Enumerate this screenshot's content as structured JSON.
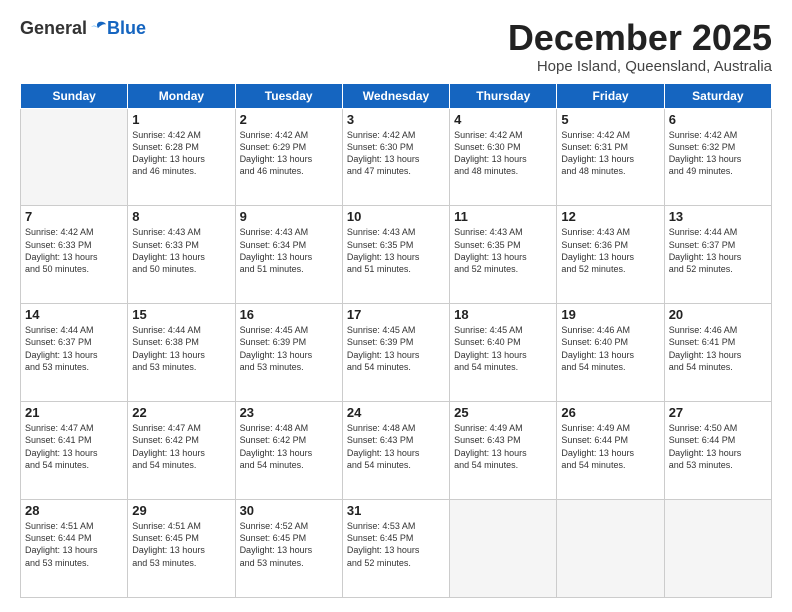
{
  "header": {
    "logo_general": "General",
    "logo_blue": "Blue",
    "month_title": "December 2025",
    "location": "Hope Island, Queensland, Australia"
  },
  "days_of_week": [
    "Sunday",
    "Monday",
    "Tuesday",
    "Wednesday",
    "Thursday",
    "Friday",
    "Saturday"
  ],
  "weeks": [
    [
      {
        "day": "",
        "info": ""
      },
      {
        "day": "1",
        "info": "Sunrise: 4:42 AM\nSunset: 6:28 PM\nDaylight: 13 hours\nand 46 minutes."
      },
      {
        "day": "2",
        "info": "Sunrise: 4:42 AM\nSunset: 6:29 PM\nDaylight: 13 hours\nand 46 minutes."
      },
      {
        "day": "3",
        "info": "Sunrise: 4:42 AM\nSunset: 6:30 PM\nDaylight: 13 hours\nand 47 minutes."
      },
      {
        "day": "4",
        "info": "Sunrise: 4:42 AM\nSunset: 6:30 PM\nDaylight: 13 hours\nand 48 minutes."
      },
      {
        "day": "5",
        "info": "Sunrise: 4:42 AM\nSunset: 6:31 PM\nDaylight: 13 hours\nand 48 minutes."
      },
      {
        "day": "6",
        "info": "Sunrise: 4:42 AM\nSunset: 6:32 PM\nDaylight: 13 hours\nand 49 minutes."
      }
    ],
    [
      {
        "day": "7",
        "info": "Sunrise: 4:42 AM\nSunset: 6:33 PM\nDaylight: 13 hours\nand 50 minutes."
      },
      {
        "day": "8",
        "info": "Sunrise: 4:43 AM\nSunset: 6:33 PM\nDaylight: 13 hours\nand 50 minutes."
      },
      {
        "day": "9",
        "info": "Sunrise: 4:43 AM\nSunset: 6:34 PM\nDaylight: 13 hours\nand 51 minutes."
      },
      {
        "day": "10",
        "info": "Sunrise: 4:43 AM\nSunset: 6:35 PM\nDaylight: 13 hours\nand 51 minutes."
      },
      {
        "day": "11",
        "info": "Sunrise: 4:43 AM\nSunset: 6:35 PM\nDaylight: 13 hours\nand 52 minutes."
      },
      {
        "day": "12",
        "info": "Sunrise: 4:43 AM\nSunset: 6:36 PM\nDaylight: 13 hours\nand 52 minutes."
      },
      {
        "day": "13",
        "info": "Sunrise: 4:44 AM\nSunset: 6:37 PM\nDaylight: 13 hours\nand 52 minutes."
      }
    ],
    [
      {
        "day": "14",
        "info": "Sunrise: 4:44 AM\nSunset: 6:37 PM\nDaylight: 13 hours\nand 53 minutes."
      },
      {
        "day": "15",
        "info": "Sunrise: 4:44 AM\nSunset: 6:38 PM\nDaylight: 13 hours\nand 53 minutes."
      },
      {
        "day": "16",
        "info": "Sunrise: 4:45 AM\nSunset: 6:39 PM\nDaylight: 13 hours\nand 53 minutes."
      },
      {
        "day": "17",
        "info": "Sunrise: 4:45 AM\nSunset: 6:39 PM\nDaylight: 13 hours\nand 54 minutes."
      },
      {
        "day": "18",
        "info": "Sunrise: 4:45 AM\nSunset: 6:40 PM\nDaylight: 13 hours\nand 54 minutes."
      },
      {
        "day": "19",
        "info": "Sunrise: 4:46 AM\nSunset: 6:40 PM\nDaylight: 13 hours\nand 54 minutes."
      },
      {
        "day": "20",
        "info": "Sunrise: 4:46 AM\nSunset: 6:41 PM\nDaylight: 13 hours\nand 54 minutes."
      }
    ],
    [
      {
        "day": "21",
        "info": "Sunrise: 4:47 AM\nSunset: 6:41 PM\nDaylight: 13 hours\nand 54 minutes."
      },
      {
        "day": "22",
        "info": "Sunrise: 4:47 AM\nSunset: 6:42 PM\nDaylight: 13 hours\nand 54 minutes."
      },
      {
        "day": "23",
        "info": "Sunrise: 4:48 AM\nSunset: 6:42 PM\nDaylight: 13 hours\nand 54 minutes."
      },
      {
        "day": "24",
        "info": "Sunrise: 4:48 AM\nSunset: 6:43 PM\nDaylight: 13 hours\nand 54 minutes."
      },
      {
        "day": "25",
        "info": "Sunrise: 4:49 AM\nSunset: 6:43 PM\nDaylight: 13 hours\nand 54 minutes."
      },
      {
        "day": "26",
        "info": "Sunrise: 4:49 AM\nSunset: 6:44 PM\nDaylight: 13 hours\nand 54 minutes."
      },
      {
        "day": "27",
        "info": "Sunrise: 4:50 AM\nSunset: 6:44 PM\nDaylight: 13 hours\nand 53 minutes."
      }
    ],
    [
      {
        "day": "28",
        "info": "Sunrise: 4:51 AM\nSunset: 6:44 PM\nDaylight: 13 hours\nand 53 minutes."
      },
      {
        "day": "29",
        "info": "Sunrise: 4:51 AM\nSunset: 6:45 PM\nDaylight: 13 hours\nand 53 minutes."
      },
      {
        "day": "30",
        "info": "Sunrise: 4:52 AM\nSunset: 6:45 PM\nDaylight: 13 hours\nand 53 minutes."
      },
      {
        "day": "31",
        "info": "Sunrise: 4:53 AM\nSunset: 6:45 PM\nDaylight: 13 hours\nand 52 minutes."
      },
      {
        "day": "",
        "info": ""
      },
      {
        "day": "",
        "info": ""
      },
      {
        "day": "",
        "info": ""
      }
    ]
  ]
}
